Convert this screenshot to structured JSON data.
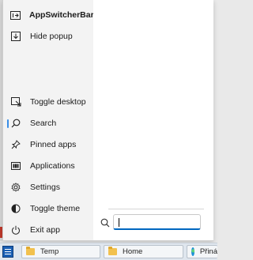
{
  "menu": {
    "items": [
      {
        "label": "AppSwitcherBar",
        "icon": "app-switcher-icon"
      },
      {
        "label": "Hide popup",
        "icon": "hide-popup-icon"
      },
      {
        "label": "Toggle desktop",
        "icon": "toggle-desktop-icon"
      },
      {
        "label": "Search",
        "icon": "search-icon"
      },
      {
        "label": "Pinned apps",
        "icon": "pin-icon"
      },
      {
        "label": "Applications",
        "icon": "applications-icon"
      },
      {
        "label": "Settings",
        "icon": "gear-icon"
      },
      {
        "label": "Toggle theme",
        "icon": "theme-icon"
      },
      {
        "label": "Exit app",
        "icon": "power-icon"
      }
    ],
    "selected": "Search"
  },
  "search": {
    "value": "",
    "placeholder": ""
  },
  "taskbar": {
    "buttons": [
      {
        "label": "Temp",
        "icon": "folder-icon"
      },
      {
        "label": "Home",
        "icon": "folder-icon"
      },
      {
        "label": "Přiná",
        "icon": "edge-icon"
      }
    ]
  },
  "colors": {
    "accent": "#0067c0",
    "selection_marker": "#3a8ee6",
    "start_button": "#1a5fb4"
  }
}
